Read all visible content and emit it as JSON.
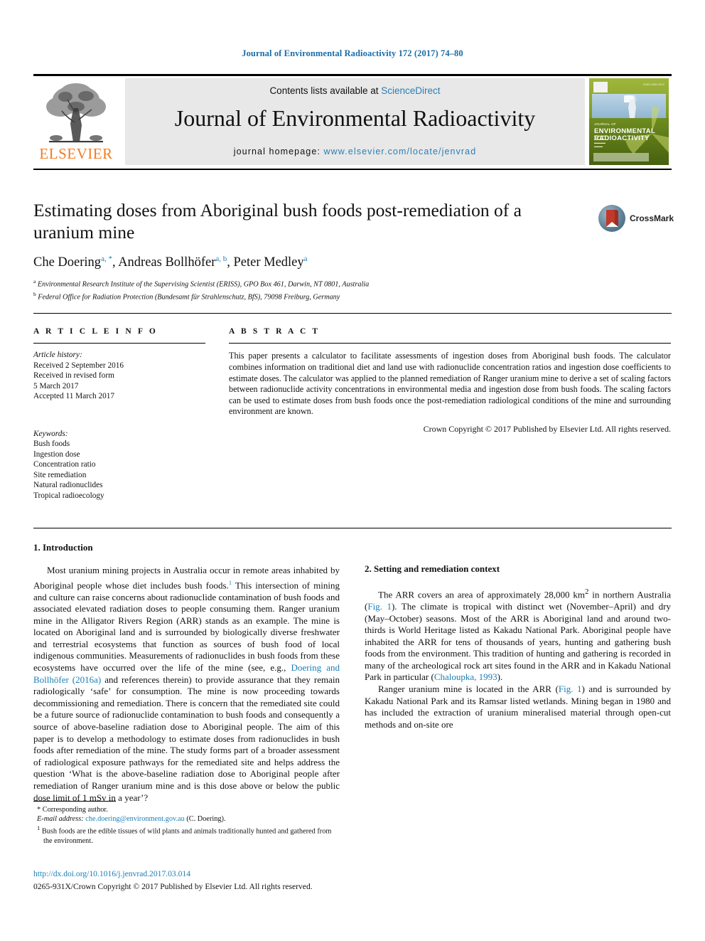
{
  "running_head": "Journal of Environmental Radioactivity 172 (2017) 74–80",
  "masthead": {
    "contents_prefix": "Contents lists available at ",
    "sciencedirect": "ScienceDirect",
    "journal_name": "Journal of Environmental Radioactivity",
    "homepage_label": "journal homepage: ",
    "homepage_url": "www.elsevier.com/locate/jenvrad",
    "publisher_logo_text": "ELSEVIER",
    "publisher_logo_color": "#f47b20",
    "link_color": "#2a7fb5",
    "cover": {
      "title_small": "JOURNAL OF",
      "title_line1": "ENVIRONMENTAL",
      "title_line2": "RADIOACTIVITY",
      "issn": "ISSN 0265-931X"
    }
  },
  "article": {
    "title": "Estimating doses from Aboriginal bush foods post-remediation of a uranium mine",
    "authors": [
      {
        "name": "Che Doering",
        "sup": "a, *"
      },
      {
        "name": "Andreas Bollhöfer",
        "sup": "a, b"
      },
      {
        "name": "Peter Medley",
        "sup": "a"
      }
    ],
    "affiliations": [
      {
        "marker": "a",
        "text": "Environmental Research Institute of the Supervising Scientist (ERISS), GPO Box 461, Darwin, NT 0801, Australia"
      },
      {
        "marker": "b",
        "text": "Federal Office for Radiation Protection (Bundesamt für Strahlenschutz, BfS), 79098 Freiburg, Germany"
      }
    ],
    "crossmark_label": "CrossMark"
  },
  "article_info": {
    "heading": "A R T I C L E   I N F O",
    "history_label": "Article history:",
    "history": [
      "Received 2 September 2016",
      "Received in revised form",
      "5 March 2017",
      "Accepted 11 March 2017"
    ],
    "keywords_label": "Keywords:",
    "keywords": [
      "Bush foods",
      "Ingestion dose",
      "Concentration ratio",
      "Site remediation",
      "Natural radionuclides",
      "Tropical radioecology"
    ]
  },
  "abstract": {
    "heading": "A B S T R A C T",
    "text": "This paper presents a calculator to facilitate assessments of ingestion doses from Aboriginal bush foods. The calculator combines information on traditional diet and land use with radionuclide concentration ratios and ingestion dose coefficients to estimate doses. The calculator was applied to the planned remediation of Ranger uranium mine to derive a set of scaling factors between radionuclide activity concentrations in environmental media and ingestion dose from bush foods. The scaling factors can be used to estimate doses from bush foods once the post-remediation radiological conditions of the mine and surrounding environment are known.",
    "copyright": "Crown Copyright © 2017 Published by Elsevier Ltd. All rights reserved."
  },
  "sections": {
    "intro_heading": "1. Introduction",
    "intro_p1_a": "Most uranium mining projects in Australia occur in remote areas inhabited by Aboriginal people whose diet includes bush foods.",
    "intro_p1_fn": "1",
    "intro_p1_b": " This intersection of mining and culture can raise concerns about radionuclide contamination of bush foods and associated elevated radiation doses to people consuming them. Ranger uranium mine in the Alligator Rivers Region (ARR) stands as an example. The mine is located on Aboriginal land and is surrounded by biologically diverse freshwater and terrestrial ecosystems that function as sources of bush food of local indigenous communities. Measurements of radionuclides in bush foods from these ecosystems have occurred over the life of the mine (see, e.g., ",
    "intro_ref1": "Doering and Bollhöfer (2016a)",
    "intro_p1_c": " and references therein) to provide assurance that they remain radiologically ‘safe’ for consumption. The mine is now proceeding towards decommissioning and remediation. There is concern that the remediated site could be a future source of radionuclide contamination to bush foods and consequently a source of above-baseline radiation dose to Aboriginal people. The aim of this paper is to develop a methodology to estimate doses from radionuclides in bush foods after remediation of the mine. The study forms part of a broader assessment of radiological exposure pathways for the remediated site and helps address the question ‘What is the above-baseline radiation dose to Aboriginal people after remediation of Ranger uranium mine and is this dose above or below the public dose limit of 1 mSv in a year’?",
    "setting_heading": "2. Setting and remediation context",
    "setting_p1_a": "The ARR covers an area of approximately 28,000 km",
    "setting_p1_sup": "2",
    "setting_p1_b": " in northern Australia (",
    "setting_ref_fig1a": "Fig. 1",
    "setting_p1_c": "). The climate is tropical with distinct wet (November–April) and dry (May–October) seasons. Most of the ARR is Aboriginal land and around two-thirds is World Heritage listed as Kakadu National Park. Aboriginal people have inhabited the ARR for tens of thousands of years, hunting and gathering bush foods from the environment. This tradition of hunting and gathering is recorded in many of the archeological rock art sites found in the ARR and in Kakadu National Park in particular (",
    "setting_ref_chaloupka": "Chaloupka, 1993",
    "setting_p1_d": ").",
    "setting_p2_a": "Ranger uranium mine is located in the ARR (",
    "setting_ref_fig1b": "Fig. 1",
    "setting_p2_b": ") and is surrounded by Kakadu National Park and its Ramsar listed wetlands. Mining began in 1980 and has included the extraction of uranium mineralised material through open-cut methods and on-site ore"
  },
  "footer": {
    "corresponding": "* Corresponding author.",
    "email_label": "E-mail address:",
    "email": "che.doering@environment.gov.au",
    "email_suffix": " (C. Doering).",
    "footnote_marker": "1",
    "footnote_text": " Bush foods are the edible tissues of wild plants and animals traditionally hunted and gathered from the environment.",
    "doi": "http://dx.doi.org/10.1016/j.jenvrad.2017.03.014",
    "issn_line": "0265-931X/Crown Copyright © 2017 Published by Elsevier Ltd. All rights reserved."
  }
}
